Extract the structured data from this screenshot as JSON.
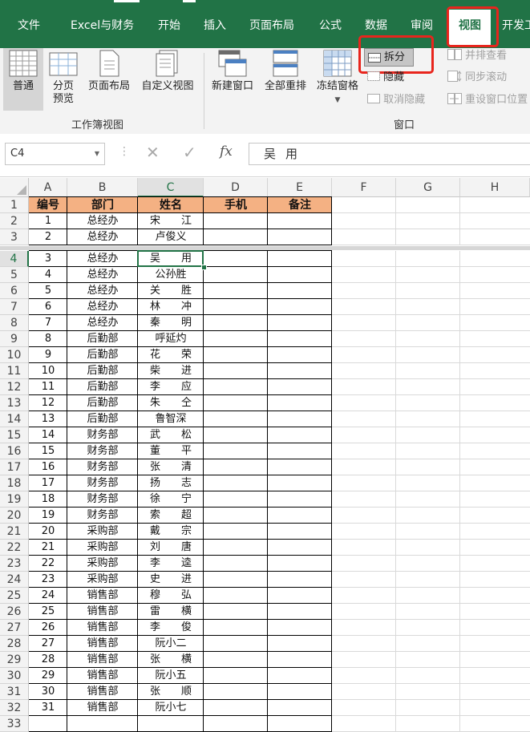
{
  "ribbon_tabs": [
    {
      "label": "文件"
    },
    {
      "label": "Excel与财务"
    },
    {
      "label": "开始"
    },
    {
      "label": "插入"
    },
    {
      "label": "页面布局"
    },
    {
      "label": "公式"
    },
    {
      "label": "数据"
    },
    {
      "label": "审阅"
    },
    {
      "label": "视图"
    },
    {
      "label": "开发工"
    }
  ],
  "workbook_views": {
    "buttons": [
      "普通",
      "分页\n预览",
      "页面布局",
      "自定义视图"
    ],
    "page_break_line1": "分页",
    "page_break_line2": "预览",
    "group_label": "工作簿视图"
  },
  "window_group": {
    "new_window": "新建窗口",
    "arrange_all": "全部重排",
    "freeze_panes": "冻结窗格",
    "split": "拆分",
    "hide": "隐藏",
    "unhide": "取消隐藏",
    "view_side_by_side": "并排查看",
    "sync_scroll": "同步滚动",
    "reset_position": "重设窗口位置",
    "group_label": "窗口"
  },
  "formula_bar": {
    "name_box": "C4",
    "fx_symbol": "fx",
    "content": "吴用"
  },
  "columns": [
    "A",
    "B",
    "C",
    "D",
    "E",
    "F",
    "G",
    "H"
  ],
  "selected_cell": "C4",
  "header_row": [
    "编号",
    "部门",
    "姓名",
    "手机",
    "备注"
  ],
  "rows": [
    {
      "r": 2,
      "id": "1",
      "dept": "总经办",
      "name": "宋江"
    },
    {
      "r": 3,
      "id": "2",
      "dept": "总经办",
      "name": "卢俊义"
    },
    {
      "r": 4,
      "id": "3",
      "dept": "总经办",
      "name": "吴用"
    },
    {
      "r": 5,
      "id": "4",
      "dept": "总经办",
      "name": "公孙胜"
    },
    {
      "r": 6,
      "id": "5",
      "dept": "总经办",
      "name": "关胜"
    },
    {
      "r": 7,
      "id": "6",
      "dept": "总经办",
      "name": "林冲"
    },
    {
      "r": 8,
      "id": "7",
      "dept": "总经办",
      "name": "秦明"
    },
    {
      "r": 9,
      "id": "8",
      "dept": "后勤部",
      "name": "呼延灼"
    },
    {
      "r": 10,
      "id": "9",
      "dept": "后勤部",
      "name": "花荣"
    },
    {
      "r": 11,
      "id": "10",
      "dept": "后勤部",
      "name": "柴进"
    },
    {
      "r": 12,
      "id": "11",
      "dept": "后勤部",
      "name": "李应"
    },
    {
      "r": 13,
      "id": "12",
      "dept": "后勤部",
      "name": "朱仝"
    },
    {
      "r": 14,
      "id": "13",
      "dept": "后勤部",
      "name": "鲁智深"
    },
    {
      "r": 15,
      "id": "14",
      "dept": "财务部",
      "name": "武松"
    },
    {
      "r": 16,
      "id": "15",
      "dept": "财务部",
      "name": "董平"
    },
    {
      "r": 17,
      "id": "16",
      "dept": "财务部",
      "name": "张清"
    },
    {
      "r": 18,
      "id": "17",
      "dept": "财务部",
      "name": "扬志"
    },
    {
      "r": 19,
      "id": "18",
      "dept": "财务部",
      "name": "徐宁"
    },
    {
      "r": 20,
      "id": "19",
      "dept": "财务部",
      "name": "索超"
    },
    {
      "r": 21,
      "id": "20",
      "dept": "采购部",
      "name": "戴宗"
    },
    {
      "r": 22,
      "id": "21",
      "dept": "采购部",
      "name": "刘唐"
    },
    {
      "r": 23,
      "id": "22",
      "dept": "采购部",
      "name": "李逵"
    },
    {
      "r": 24,
      "id": "23",
      "dept": "采购部",
      "name": "史进"
    },
    {
      "r": 25,
      "id": "24",
      "dept": "销售部",
      "name": "穆弘"
    },
    {
      "r": 26,
      "id": "25",
      "dept": "销售部",
      "name": "雷横"
    },
    {
      "r": 27,
      "id": "26",
      "dept": "销售部",
      "name": "李俊"
    },
    {
      "r": 28,
      "id": "27",
      "dept": "销售部",
      "name": "阮小二"
    },
    {
      "r": 29,
      "id": "28",
      "dept": "销售部",
      "name": "张横"
    },
    {
      "r": 30,
      "id": "29",
      "dept": "销售部",
      "name": "阮小五"
    },
    {
      "r": 31,
      "id": "30",
      "dept": "销售部",
      "name": "张顺"
    },
    {
      "r": 32,
      "id": "31",
      "dept": "销售部",
      "name": "阮小七"
    }
  ],
  "colors": {
    "ribbon_green": "#217346",
    "header_fill": "#f4b183",
    "highlight_red": "#e8251d"
  }
}
